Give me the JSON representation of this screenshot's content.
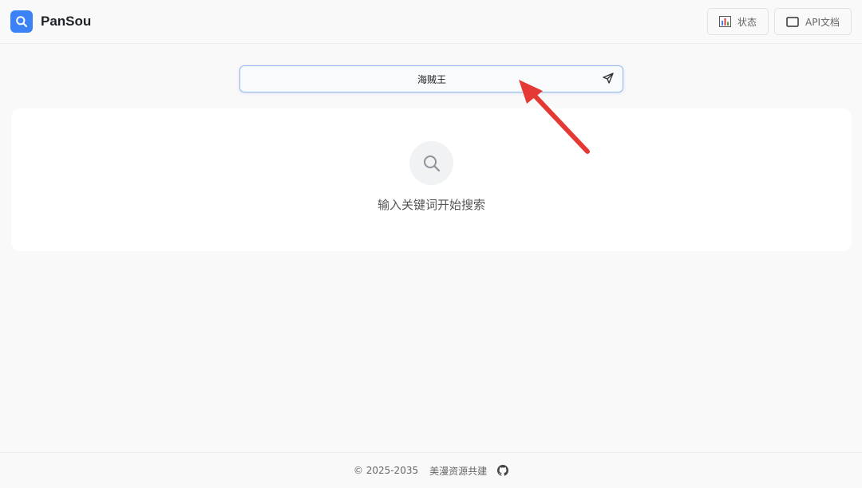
{
  "app": {
    "name": "PanSou"
  },
  "header": {
    "status_label": "状态",
    "api_label": "API文档"
  },
  "search": {
    "value": "海贼王",
    "placeholder": ""
  },
  "empty_state": {
    "message": "输入关键词开始搜索"
  },
  "footer": {
    "copyright": "© 2025-2035",
    "credit": "美漫资源共建"
  },
  "colors": {
    "brand": "#3b82f6",
    "annotation_arrow": "#e53935"
  },
  "icons": {
    "logo": "search-icon",
    "status": "bar-chart-icon",
    "api": "document-icon",
    "send": "send-icon",
    "empty": "search-icon",
    "footer": "github-icon"
  }
}
